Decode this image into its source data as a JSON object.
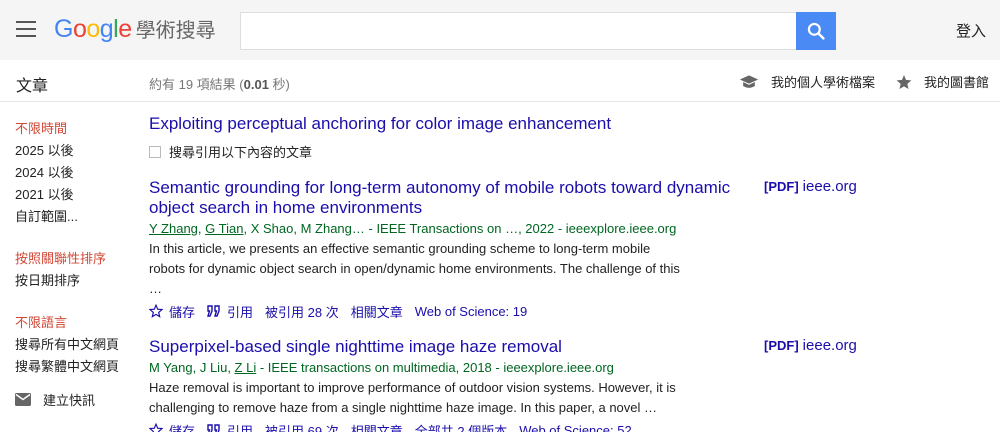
{
  "header": {
    "logo_letters": [
      {
        "ch": "G",
        "color": "#4285f4"
      },
      {
        "ch": "o",
        "color": "#ea4335"
      },
      {
        "ch": "o",
        "color": "#fbbc05"
      },
      {
        "ch": "g",
        "color": "#4285f4"
      },
      {
        "ch": "l",
        "color": "#34a853"
      },
      {
        "ch": "e",
        "color": "#ea4335"
      }
    ],
    "logo_suffix": "學術搜尋",
    "search_value": "",
    "login": "登入"
  },
  "subheader": {
    "section_title": "文章",
    "stats_prefix": "約有 19 項結果 (",
    "stats_time": "0.01",
    "stats_suffix": " 秒)",
    "my_profile": "我的個人學術檔案",
    "my_library": "我的圖書館"
  },
  "sidebar": {
    "time_any": "不限時間",
    "time_2025": "2025 以後",
    "time_2024": "2024 以後",
    "time_2021": "2021 以後",
    "time_custom": "自訂範圍...",
    "sort_relevance": "按照關聯性排序",
    "sort_date": "按日期排序",
    "lang_any": "不限語言",
    "lang_simplified": "搜尋所有中文網頁",
    "lang_traditional": "搜尋繁體中文網頁",
    "create_alert": "建立快訊"
  },
  "results": {
    "cited_title": "Exploiting perceptual anchoring for color image enhancement",
    "cited_checkbox_label": "搜尋引用以下內容的文章",
    "r1": {
      "title": "Semantic grounding for long-term autonomy of mobile robots toward dynamic object search in home environments",
      "authors": [
        {
          "name": "Y Zhang",
          "linked": true
        },
        {
          "name": "G Tian",
          "linked": true
        },
        {
          "name": "X Shao",
          "linked": false
        },
        {
          "name": "M Zhang…",
          "linked": false
        }
      ],
      "source": " - IEEE Transactions on …, 2022 - ieeexplore.ieee.org",
      "snippet_1": "In this article, we presents an effective semantic grounding scheme to long-term mobile",
      "snippet_2": "robots for dynamic object search in open/dynamic home environments. The challenge of this …",
      "save": "儲存",
      "cite": "引用",
      "cited_by": "被引用 28 次",
      "related": "相關文章",
      "wos": "Web of Science: 19",
      "pdf_tag": "[PDF]",
      "pdf_source": "ieee.org"
    },
    "r2": {
      "title": "Superpixel-based single nighttime image haze removal",
      "authors": [
        {
          "name": "M Yang",
          "linked": false
        },
        {
          "name": "J Liu",
          "linked": false
        },
        {
          "name": "Z Li",
          "linked": true
        }
      ],
      "source": " - IEEE transactions on multimedia, 2018 - ieeexplore.ieee.org",
      "snippet_1": "Haze removal is important to improve performance of outdoor vision systems. However, it is",
      "snippet_2": "challenging to remove haze from a single nighttime haze image. In this paper, a novel …",
      "save": "儲存",
      "cite": "引用",
      "cited_by": "被引用 69 次",
      "related": "相關文章",
      "versions": "全部共 2 個版本",
      "wos": "Web of Science: 52",
      "pdf_tag": "[PDF]",
      "pdf_source": "ieee.org"
    }
  },
  "colors": {
    "link": "#1a0dab",
    "green": "#006621",
    "active_red": "#d14836",
    "search_blue": "#4a8af4"
  },
  "icons": [
    "menu-icon",
    "search-icon",
    "graduation-cap-icon",
    "star-icon",
    "mail-icon",
    "star-outline-icon",
    "quote-icon",
    "checkbox"
  ]
}
